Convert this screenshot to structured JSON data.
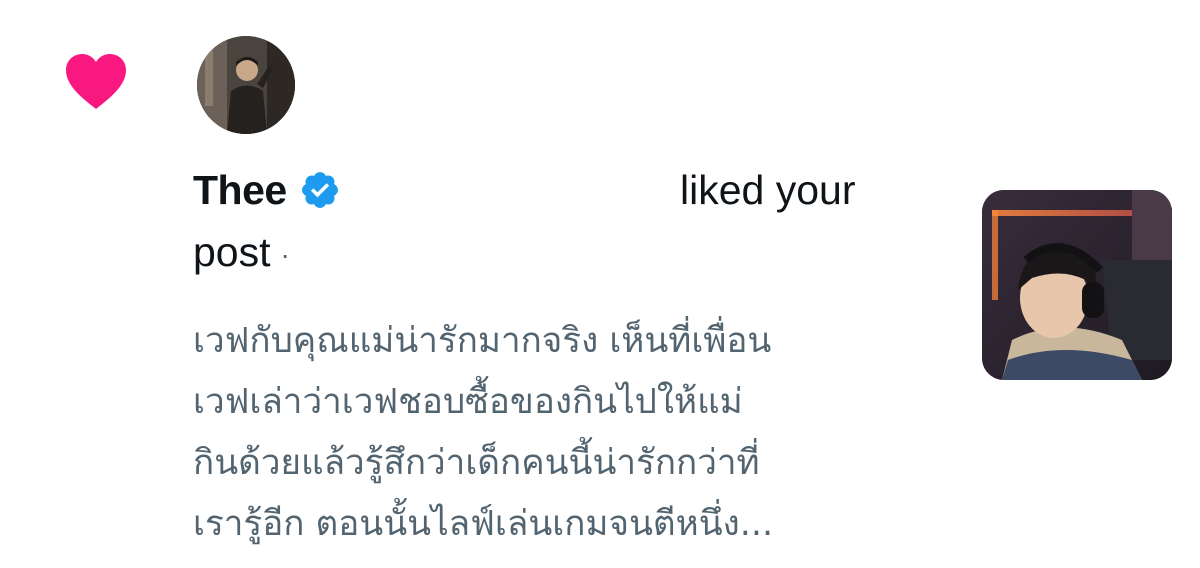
{
  "notification": {
    "icon": "heart-icon",
    "heart_color": "#f91880",
    "user": {
      "name": "Thee",
      "verified_icon": "verified-badge-icon",
      "verified_color": "#1d9bf0"
    },
    "action_text": "liked your",
    "action_text_cont": "post",
    "separator": "·",
    "post_preview_lines": [
      "เวฟกับคุณแม่น่ารักมากจริง เห็นที่เพื่อน",
      "เวฟเล่าว่าเวฟชอบซื้อของกินไปให้แม่",
      "กินด้วยแล้วรู้สึกว่าเด็กคนนี้น่ารักกว่าที่",
      "เรารู้อีก ตอนนั้นไลฟ์เล่นเกมจนตีหนึ่ง..."
    ]
  },
  "colors": {
    "text_primary": "#0f1419",
    "text_secondary": "#536471",
    "background": "#ffffff"
  }
}
